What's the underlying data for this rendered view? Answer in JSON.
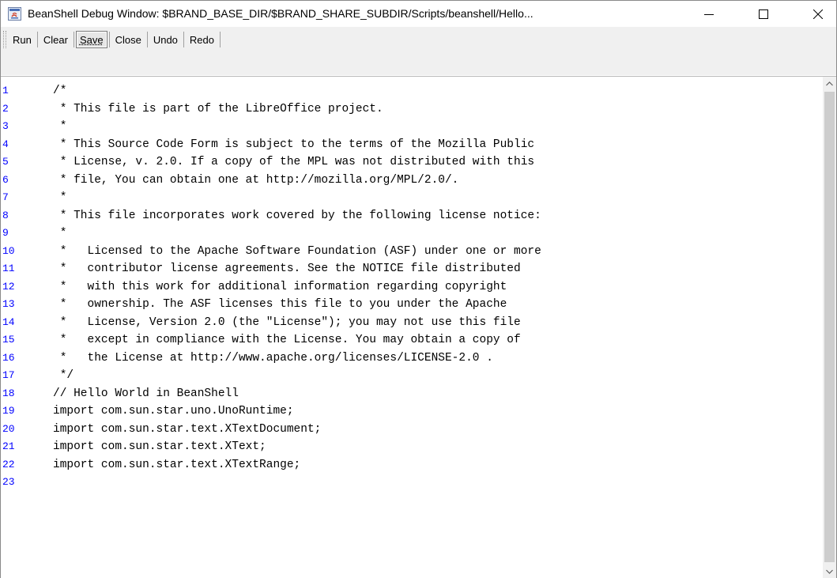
{
  "window": {
    "title": "BeanShell Debug Window: $BRAND_BASE_DIR/$BRAND_SHARE_SUBDIR/Scripts/beanshell/Hello...",
    "icon": "java-app-icon",
    "controls": {
      "minimize": "minimize-icon",
      "maximize": "maximize-icon",
      "close": "close-icon"
    }
  },
  "toolbar": {
    "buttons": [
      {
        "label": "Run"
      },
      {
        "label": "Clear"
      },
      {
        "label": "Save"
      },
      {
        "label": "Close"
      },
      {
        "label": "Undo"
      },
      {
        "label": "Redo"
      }
    ],
    "focused": "Save"
  },
  "editor": {
    "line_number_color": "#0000ff",
    "lines": [
      {
        "n": "1",
        "text": "/*"
      },
      {
        "n": "2",
        "text": " * This file is part of the LibreOffice project."
      },
      {
        "n": "3",
        "text": " *"
      },
      {
        "n": "4",
        "text": " * This Source Code Form is subject to the terms of the Mozilla Public"
      },
      {
        "n": "5",
        "text": " * License, v. 2.0. If a copy of the MPL was not distributed with this"
      },
      {
        "n": "6",
        "text": " * file, You can obtain one at http://mozilla.org/MPL/2.0/."
      },
      {
        "n": "7",
        "text": " *"
      },
      {
        "n": "8",
        "text": " * This file incorporates work covered by the following license notice:"
      },
      {
        "n": "9",
        "text": " *"
      },
      {
        "n": "10",
        "text": " *   Licensed to the Apache Software Foundation (ASF) under one or more"
      },
      {
        "n": "11",
        "text": " *   contributor license agreements. See the NOTICE file distributed"
      },
      {
        "n": "12",
        "text": " *   with this work for additional information regarding copyright"
      },
      {
        "n": "13",
        "text": " *   ownership. The ASF licenses this file to you under the Apache"
      },
      {
        "n": "14",
        "text": " *   License, Version 2.0 (the \"License\"); you may not use this file"
      },
      {
        "n": "15",
        "text": " *   except in compliance with the License. You may obtain a copy of"
      },
      {
        "n": "16",
        "text": " *   the License at http://www.apache.org/licenses/LICENSE-2.0 ."
      },
      {
        "n": "17",
        "text": " */"
      },
      {
        "n": "18",
        "text": "// Hello World in BeanShell"
      },
      {
        "n": "19",
        "text": "import com.sun.star.uno.UnoRuntime;"
      },
      {
        "n": "20",
        "text": "import com.sun.star.text.XTextDocument;"
      },
      {
        "n": "21",
        "text": "import com.sun.star.text.XText;"
      },
      {
        "n": "22",
        "text": "import com.sun.star.text.XTextRange;"
      },
      {
        "n": "23",
        "text": ""
      }
    ]
  },
  "scrollbar": {
    "up_icon": "scroll-up-arrow-icon",
    "down_icon": "scroll-down-arrow-icon"
  }
}
